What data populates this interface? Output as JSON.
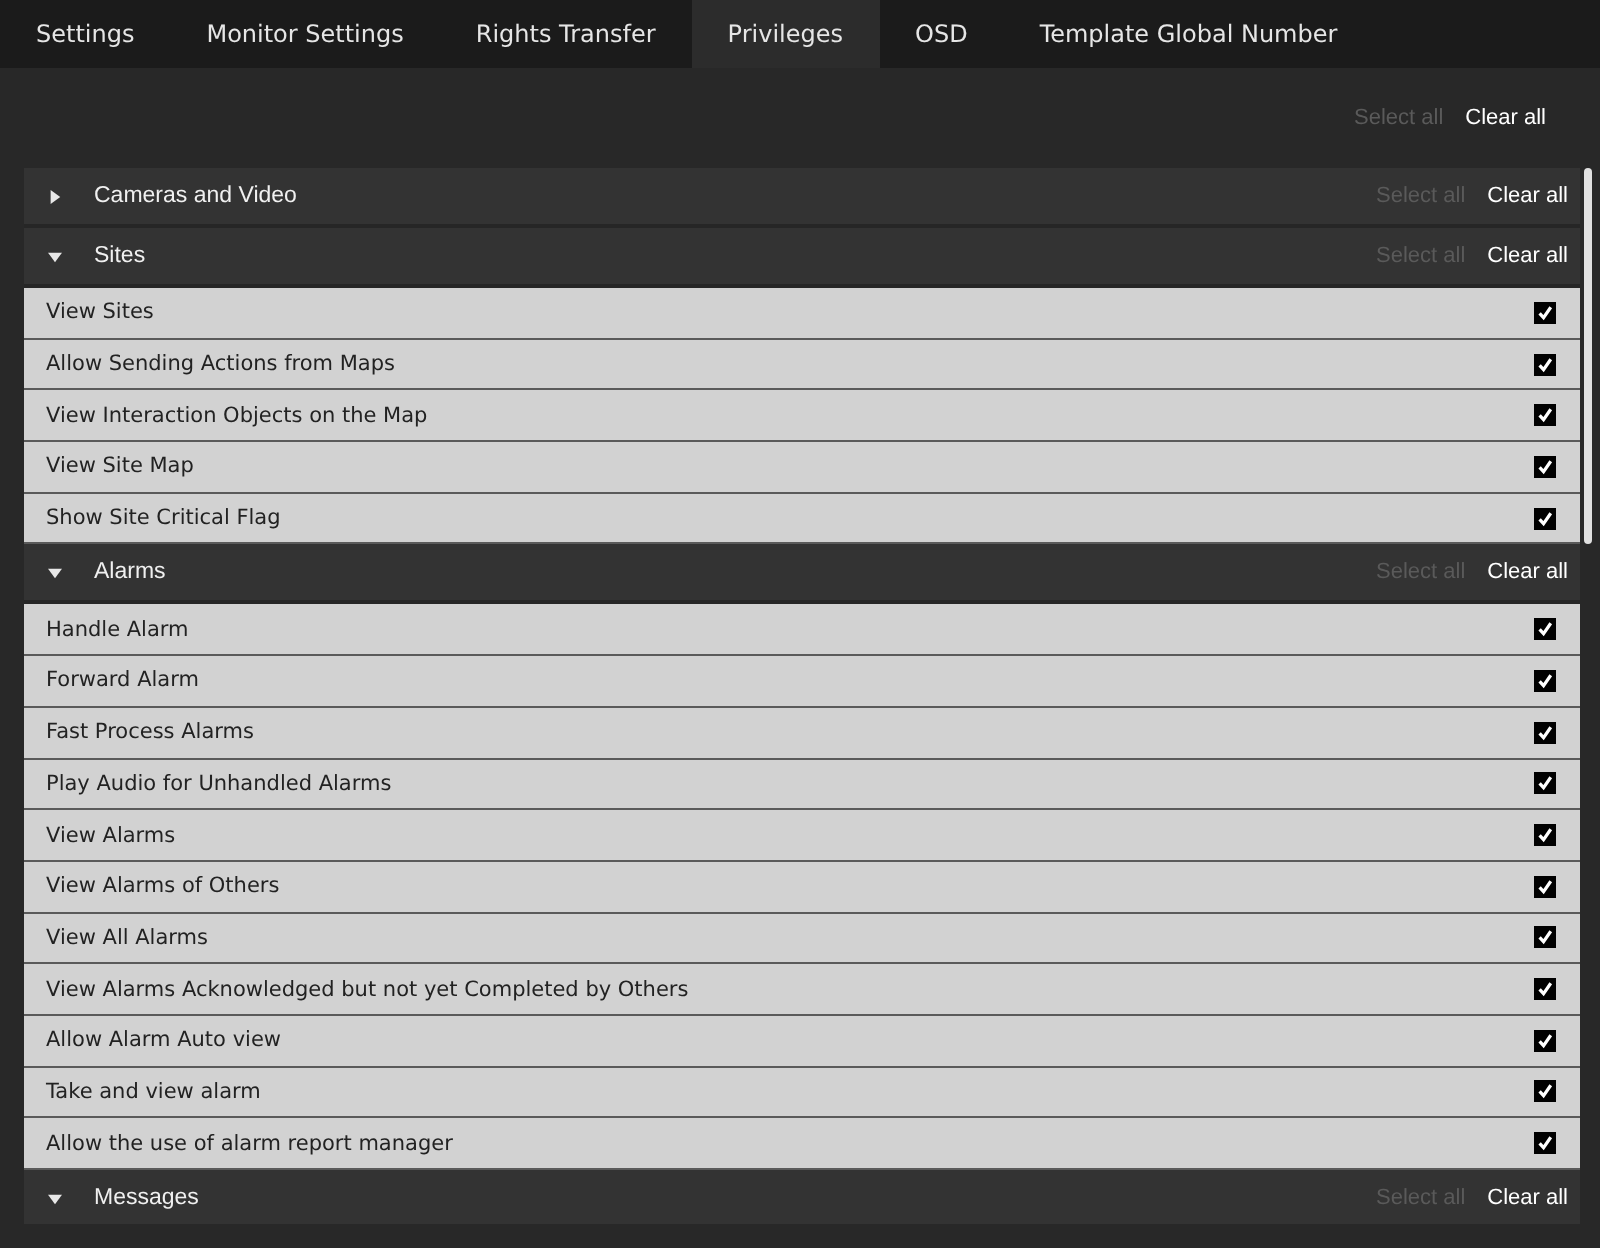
{
  "tabs": [
    {
      "label": "Settings",
      "selected": false
    },
    {
      "label": "Monitor Settings",
      "selected": false
    },
    {
      "label": "Rights Transfer",
      "selected": false
    },
    {
      "label": "Privileges",
      "selected": true
    },
    {
      "label": "OSD",
      "selected": false
    },
    {
      "label": "Template Global Number",
      "selected": false
    }
  ],
  "toolbar": {
    "select_all": {
      "label": "Select all",
      "disabled": true
    },
    "clear_all": {
      "label": "Clear all",
      "disabled": false
    }
  },
  "groups": [
    {
      "title": "Cameras and Video",
      "expanded": false,
      "select_all": {
        "label": "Select all",
        "disabled": true
      },
      "clear_all": {
        "label": "Clear all",
        "disabled": false
      }
    },
    {
      "title": "Sites",
      "expanded": true,
      "select_all": {
        "label": "Select all",
        "disabled": true
      },
      "clear_all": {
        "label": "Clear all",
        "disabled": false
      },
      "items": [
        {
          "label": "View Sites",
          "checked": true
        },
        {
          "label": "Allow Sending Actions from Maps",
          "checked": true
        },
        {
          "label": "View Interaction Objects on the Map",
          "checked": true
        },
        {
          "label": "View Site Map",
          "checked": true
        },
        {
          "label": "Show Site Critical Flag",
          "checked": true
        }
      ]
    },
    {
      "title": "Alarms",
      "expanded": true,
      "select_all": {
        "label": "Select all",
        "disabled": true
      },
      "clear_all": {
        "label": "Clear all",
        "disabled": false
      },
      "items": [
        {
          "label": "Handle Alarm",
          "checked": true
        },
        {
          "label": "Forward Alarm",
          "checked": true
        },
        {
          "label": "Fast Process Alarms",
          "checked": true
        },
        {
          "label": "Play Audio for Unhandled Alarms",
          "checked": true
        },
        {
          "label": "View Alarms",
          "checked": true
        },
        {
          "label": "View Alarms of Others",
          "checked": true
        },
        {
          "label": "View All Alarms",
          "checked": true
        },
        {
          "label": "View Alarms Acknowledged but not yet Completed by Others",
          "checked": true
        },
        {
          "label": "Allow Alarm Auto view",
          "checked": true
        },
        {
          "label": "Take and view alarm",
          "checked": true
        },
        {
          "label": "Allow the use of alarm report manager",
          "checked": true
        }
      ]
    },
    {
      "title": "Messages",
      "expanded": true,
      "select_all": {
        "label": "Select all",
        "disabled": true
      },
      "clear_all": {
        "label": "Clear all",
        "disabled": false
      }
    }
  ]
}
